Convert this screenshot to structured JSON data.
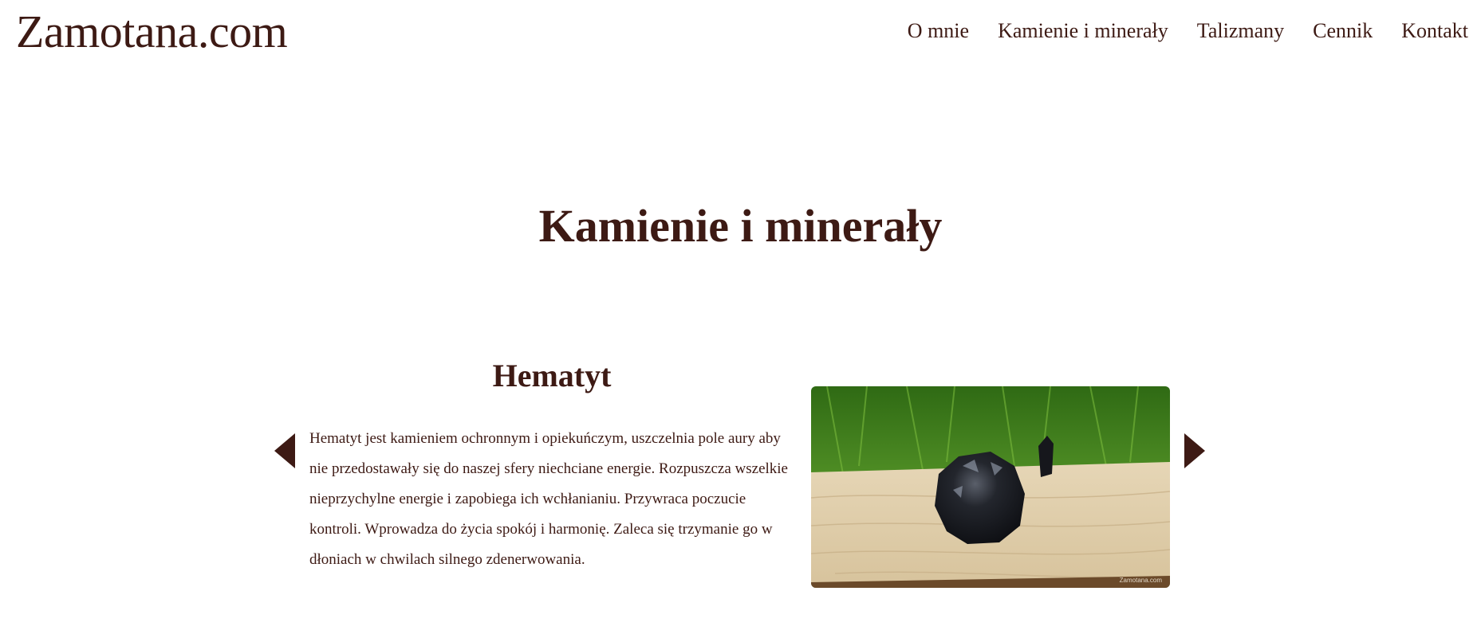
{
  "site": {
    "logo": "Zamotana.com"
  },
  "nav": {
    "items": [
      {
        "label": "O mnie"
      },
      {
        "label": "Kamienie i minerały"
      },
      {
        "label": "Talizmany"
      },
      {
        "label": "Cennik"
      },
      {
        "label": "Kontakt"
      }
    ]
  },
  "main": {
    "title": "Kamienie i minerały"
  },
  "slider": {
    "slide": {
      "title": "Hematyt",
      "description": "Hematyt jest kamieniem ochronnym i opiekuńczym, uszczelnia pole aury aby nie przedostawały się do naszej sfery niechciane energie. Rozpuszcza wszelkie nieprzychylne energie i zapobiega ich wchłanianiu. Przywraca poczucie kontroli. Wprowadza do życia spokój i harmonię. Zaleca się trzymanie go w dłoniach w chwilach silnego zdenerwowania.",
      "photo_watermark": "Zamotana.com"
    },
    "prev_icon": "chevron-left-icon",
    "next_icon": "chevron-right-icon"
  },
  "colors": {
    "text": "#3d1a14",
    "background": "#ffffff",
    "grass": "#3f7a1f",
    "wood": "#e9dcc2",
    "stone": "#1b1d22"
  }
}
